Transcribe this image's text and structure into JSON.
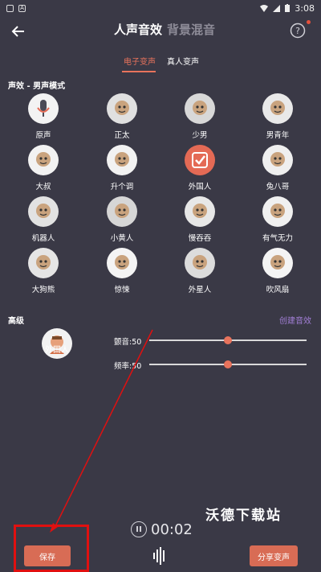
{
  "status": {
    "time": "3:08"
  },
  "header": {
    "tab_voice": "人声音效",
    "tab_background": "背景混音"
  },
  "subtabs": {
    "electronic": "电子变声",
    "real": "真人变声"
  },
  "section": {
    "effects_title": "声效 - 男声模式",
    "advanced_title": "高级",
    "create_label": "创建音效"
  },
  "effects": [
    {
      "label": "原声",
      "icon": "microphone-icon",
      "color": "#f3f3f3"
    },
    {
      "label": "正太",
      "icon": "boy-robot-icon",
      "color": "#e0e0e0"
    },
    {
      "label": "少男",
      "icon": "teen-robot-icon",
      "color": "#d8d8d8"
    },
    {
      "label": "男青年",
      "icon": "young-man-icon",
      "color": "#e9e9e9"
    },
    {
      "label": "大叔",
      "icon": "uncle-icon",
      "color": "#f2f2f2"
    },
    {
      "label": "升个调",
      "icon": "pitch-up-icon",
      "color": "#f2f2f2"
    },
    {
      "label": "外国人",
      "icon": "foreigner-check-icon",
      "color": "#e46a55"
    },
    {
      "label": "兔八哥",
      "icon": "rabbit-icon",
      "color": "#efefef"
    },
    {
      "label": "机器人",
      "icon": "robot-icon",
      "color": "#e2e2e2"
    },
    {
      "label": "小黄人",
      "icon": "minion-icon",
      "color": "#d6d6d6"
    },
    {
      "label": "慢吞吞",
      "icon": "turtle-icon",
      "color": "#e7e7e7"
    },
    {
      "label": "有气无力",
      "icon": "tired-icon",
      "color": "#f0f0f0"
    },
    {
      "label": "大狗熊",
      "icon": "bear-icon",
      "color": "#e5e5e5"
    },
    {
      "label": "惊悚",
      "icon": "monster-icon",
      "color": "#f4f4f4"
    },
    {
      "label": "外星人",
      "icon": "alien-icon",
      "color": "#dcdcdc"
    },
    {
      "label": "吹风扇",
      "icon": "fan-icon",
      "color": "#f4f4f4"
    }
  ],
  "advanced": {
    "selected_label": "外国人",
    "tremolo_label": "颤音:50",
    "tremolo_value": 50,
    "frequency_label": "频率:50",
    "frequency_value": 50
  },
  "player": {
    "time": "00:02"
  },
  "buttons": {
    "save": "保存",
    "share": "分享变声"
  },
  "watermark": "沃德下载站",
  "colors": {
    "accent": "#e8735c",
    "background": "#3a3946",
    "link": "#a27fd6",
    "highlight": "#e01010"
  }
}
